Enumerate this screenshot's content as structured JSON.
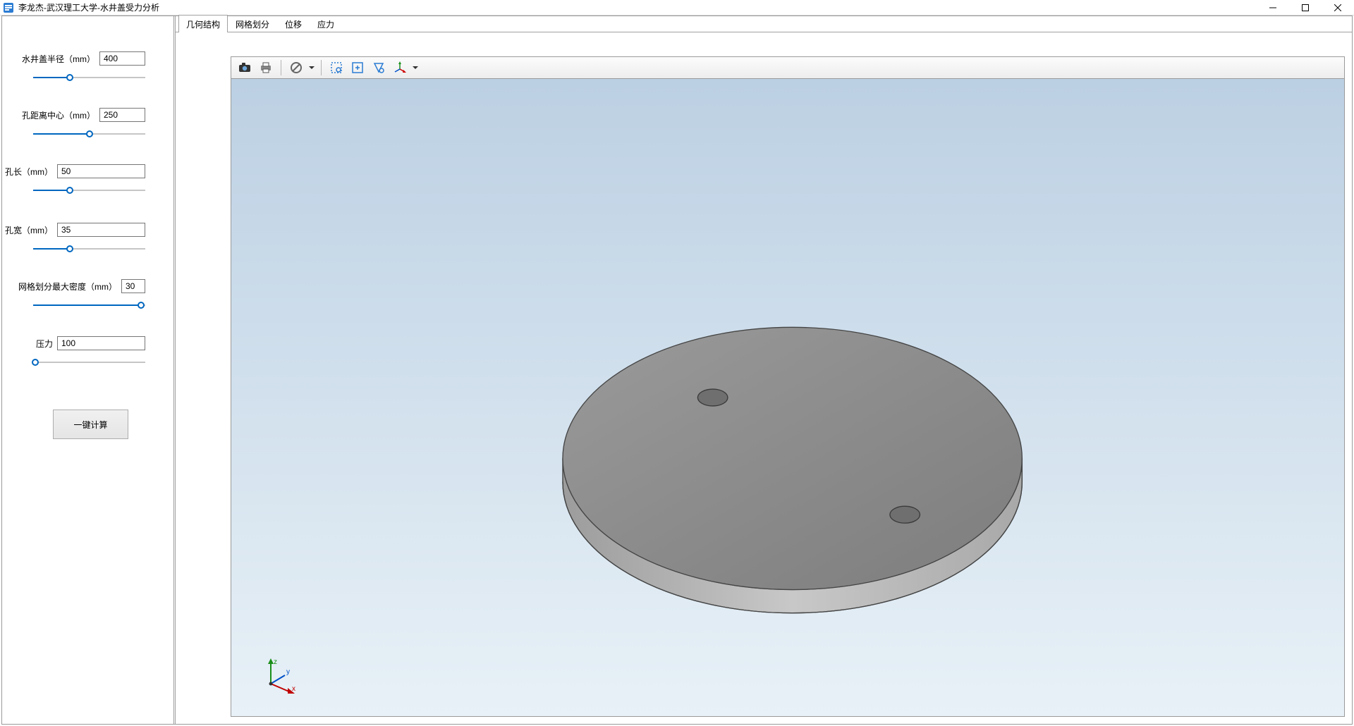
{
  "window": {
    "title": "李龙杰-武汉理工大学-水井盖受力分析",
    "icons": {
      "app": "app-icon",
      "min": "minimize-icon",
      "max": "maximize-icon",
      "close": "close-icon"
    }
  },
  "params": [
    {
      "id": "radius",
      "label": "水井盖半径（mm）",
      "value": "400",
      "fill_pct": 33,
      "input_wide": false
    },
    {
      "id": "hole_off",
      "label": "孔距离中心（mm）",
      "value": "250",
      "fill_pct": 50,
      "input_wide": false
    },
    {
      "id": "hole_len",
      "label": "孔长（mm）",
      "value": "50",
      "fill_pct": 33,
      "input_wide": true
    },
    {
      "id": "hole_w",
      "label": "孔宽（mm）",
      "value": "35",
      "fill_pct": 33,
      "input_wide": true
    },
    {
      "id": "mesh",
      "label": "网格划分最大密度（mm）",
      "value": "30",
      "fill_pct": 96,
      "input_wide": false
    },
    {
      "id": "pressure",
      "label": "压力",
      "value": "100",
      "fill_pct": 2,
      "input_wide": true
    }
  ],
  "compute_label": "一键计算",
  "tabs": [
    {
      "id": "geom",
      "label": "几何结构",
      "active": true
    },
    {
      "id": "mesh",
      "label": "网格划分",
      "active": false
    },
    {
      "id": "disp",
      "label": "位移",
      "active": false
    },
    {
      "id": "stress",
      "label": "应力",
      "active": false
    }
  ],
  "toolbar": [
    {
      "id": "camera",
      "icon": "camera-icon",
      "dropdown": false
    },
    {
      "id": "print",
      "icon": "print-icon",
      "dropdown": false
    },
    {
      "id": "sep1",
      "sep": true
    },
    {
      "id": "nosel",
      "icon": "no-select-icon",
      "dropdown": true
    },
    {
      "id": "sep2",
      "sep": true
    },
    {
      "id": "zoombox",
      "icon": "zoom-box-icon",
      "dropdown": false
    },
    {
      "id": "fit",
      "icon": "fit-view-icon",
      "dropdown": false
    },
    {
      "id": "zoomsel",
      "icon": "zoom-select-icon",
      "dropdown": false
    },
    {
      "id": "orient",
      "icon": "orient-icon",
      "dropdown": true
    }
  ],
  "triad": {
    "x": "x",
    "y": "y",
    "z": "z"
  },
  "colors": {
    "accent": "#0067c0",
    "disc_top": "#8e8e8e",
    "disc_side": "#b3b3b3"
  }
}
